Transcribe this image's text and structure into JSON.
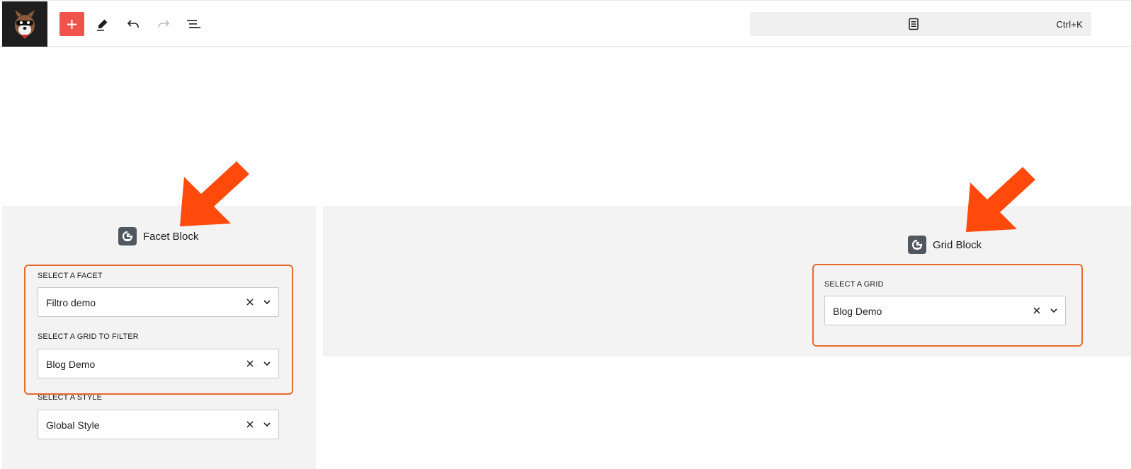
{
  "toolbar": {
    "add_icon": "plus-icon",
    "edit_icon": "pencil-icon",
    "undo_icon": "undo-icon",
    "redo_icon": "redo-icon",
    "list_view_icon": "list-view-icon",
    "command_palette": {
      "icon": "document-icon",
      "shortcut": "Ctrl+K"
    }
  },
  "facet_block": {
    "title": "Facet Block",
    "icon": "block-logo-icon",
    "fields": [
      {
        "label": "SELECT A FACET",
        "value": "Filtro demo"
      },
      {
        "label": "SELECT A GRID TO FILTER",
        "value": "Blog Demo"
      },
      {
        "label": "SELECT A STYLE",
        "value": "Global Style"
      }
    ]
  },
  "grid_block": {
    "title": "Grid Block",
    "icon": "block-logo-icon",
    "fields": [
      {
        "label": "SELECT A GRID",
        "value": "Blog Demo"
      }
    ]
  },
  "colors": {
    "accent_add": "#f0524c",
    "annotation_arrow": "#ff4a0c",
    "annotation_outline": "#e8692e",
    "block_background": "#f3f3f3"
  }
}
